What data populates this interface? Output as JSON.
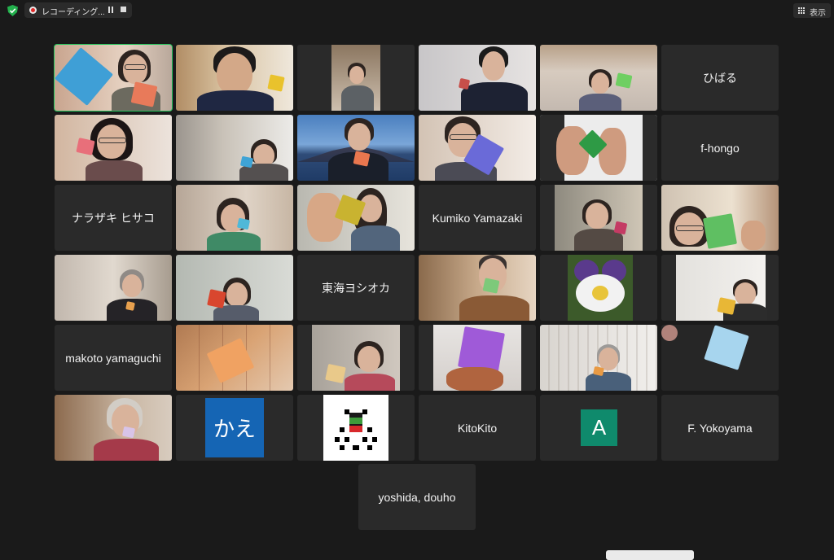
{
  "topbar": {
    "recording_label": "レコーディング...",
    "view_label": "表示"
  },
  "named_tiles": {
    "hibaru": "ひばる",
    "f_hongo": "f-hongo",
    "narazaki": "ナラザキ ヒサコ",
    "kumiko": "Kumiko Yamazaki",
    "tokai": "東海ヨシオカ",
    "makoto": "makoto yamaguchi",
    "kito": "KitoKito",
    "yokoyama": "F. Yokoyama",
    "yoshida": "yoshida, douho"
  },
  "avatars": {
    "kae": "かえ",
    "a": "A"
  },
  "colors": {
    "active_speaker": "#22c35a",
    "recording": "#e02828",
    "kae_avatar": "#1565b4",
    "a_avatar": "#0f8a6c"
  }
}
